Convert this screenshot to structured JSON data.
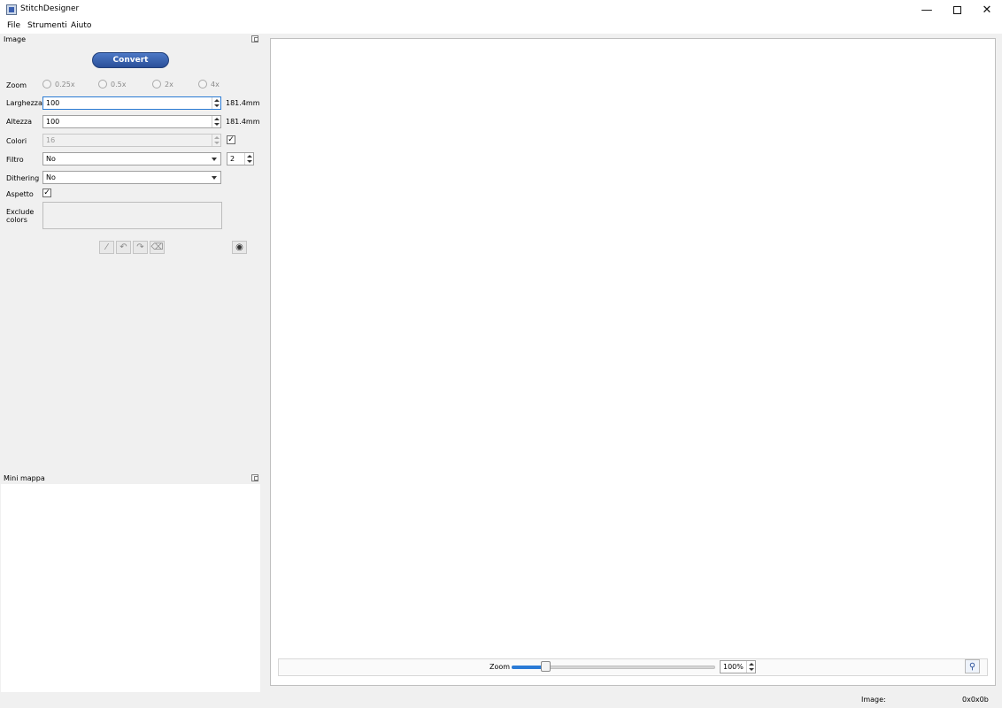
{
  "window": {
    "title": "StitchDesigner",
    "minimize_glyph": "—",
    "close_glyph": "✕"
  },
  "menu": [
    "File",
    "Strumenti",
    "Aiuto"
  ],
  "image_panel": {
    "title": "Image",
    "convert_label": "Convert",
    "zoom": {
      "label": "Zoom",
      "options": [
        "0.25x",
        "0.5x",
        "2x",
        "4x"
      ]
    },
    "larghezza": {
      "label": "Larghezza",
      "value": "100",
      "mm": "181.4mm"
    },
    "altezza": {
      "label": "Altezza",
      "value": "100",
      "mm": "181.4mm"
    },
    "colori": {
      "label": "Colori",
      "value": "16",
      "checked": true
    },
    "filtro": {
      "label": "Filtro",
      "value": "No",
      "strength": "2"
    },
    "dithering": {
      "label": "Dithering",
      "value": "No"
    },
    "aspetto": {
      "label": "Aspetto",
      "checked": true
    },
    "exclude": {
      "label_line1": "Exclude",
      "label_line2": "colors"
    },
    "tools": [
      "eyedropper-icon",
      "undo-icon",
      "redo-icon",
      "clear-icon",
      "eye-icon"
    ]
  },
  "mini_map": {
    "title": "Mini mappa"
  },
  "viewer": {
    "zoom_label": "Zoom",
    "zoom_value": "100%",
    "zoom_slider_percent": 17
  },
  "status": {
    "image_label": "Image:",
    "image_info": "0x0x0b"
  },
  "check_glyph": "✓"
}
